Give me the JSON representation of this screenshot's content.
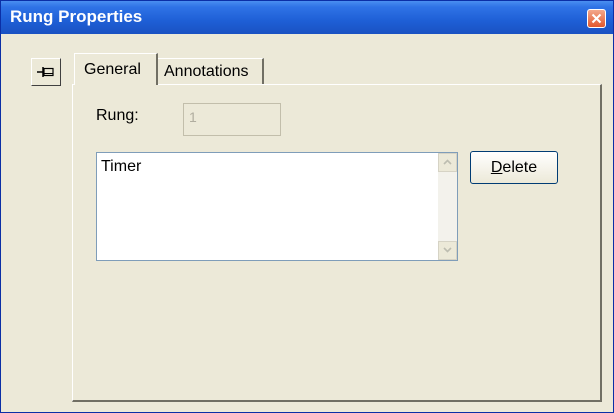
{
  "window": {
    "title": "Rung Properties",
    "close_icon": "close-icon",
    "colors": {
      "titlebar": "#2f73e6",
      "face": "#ece9d8",
      "close": "#e2582e"
    }
  },
  "pin": {
    "icon": "pin-icon"
  },
  "tabs": [
    {
      "label": "General",
      "selected": true
    },
    {
      "label": "Annotations",
      "selected": false
    }
  ],
  "general": {
    "rung_label": "Rung:",
    "rung_value": "1",
    "rung_enabled": false,
    "list_items": [
      "Timer"
    ],
    "delete_button": {
      "accel": "D",
      "rest": "elete"
    }
  }
}
